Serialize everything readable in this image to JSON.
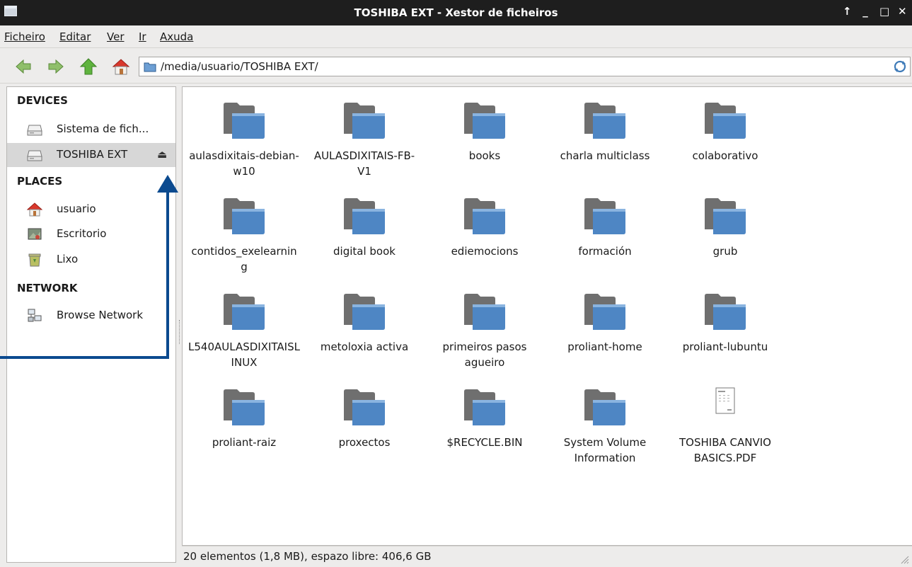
{
  "window": {
    "title": "TOSHIBA EXT - Xestor de ficheiros",
    "controls": [
      "↑",
      "_",
      "□",
      "✕"
    ]
  },
  "menu": [
    {
      "label": "Ficheiro"
    },
    {
      "label": "Editar"
    },
    {
      "label": "Ver"
    },
    {
      "label": "Ir"
    },
    {
      "label": "Axuda"
    }
  ],
  "toolbar": {
    "back_icon": "back-arrow-icon",
    "forward_icon": "forward-arrow-icon",
    "up_icon": "up-arrow-icon",
    "home_icon": "home-icon",
    "path": "/media/usuario/TOSHIBA EXT/",
    "refresh_icon": "refresh-icon"
  },
  "sidebar": {
    "devices_header": "DEVICES",
    "devices": [
      {
        "label": "Sistema de fich...",
        "icon": "drive-icon"
      },
      {
        "label": "TOSHIBA EXT",
        "icon": "drive-icon",
        "selected": true,
        "eject": "⏏"
      }
    ],
    "places_header": "PLACES",
    "places": [
      {
        "label": "usuario",
        "icon": "home-icon"
      },
      {
        "label": "Escritorio",
        "icon": "desktop-icon"
      },
      {
        "label": "Lixo",
        "icon": "trash-icon"
      }
    ],
    "network_header": "NETWORK",
    "network": [
      {
        "label": "Browse Network",
        "icon": "network-icon"
      }
    ]
  },
  "files": [
    {
      "name": "aulasdixitais-debian-w10",
      "type": "folder"
    },
    {
      "name": "AULASDIXITAIS-FB-V1",
      "type": "folder"
    },
    {
      "name": "books",
      "type": "folder"
    },
    {
      "name": "charla multiclass",
      "type": "folder"
    },
    {
      "name": "colaborativo",
      "type": "folder"
    },
    {
      "name": "contidos_exelearning",
      "type": "folder"
    },
    {
      "name": "digital book",
      "type": "folder"
    },
    {
      "name": "ediemocions",
      "type": "folder"
    },
    {
      "name": "formación",
      "type": "folder"
    },
    {
      "name": "grub",
      "type": "folder"
    },
    {
      "name": "L540AULASDIXITAISLINUX",
      "type": "folder"
    },
    {
      "name": "metoloxia activa",
      "type": "folder"
    },
    {
      "name": "primeiros pasos agueiro",
      "type": "folder"
    },
    {
      "name": "proliant-home",
      "type": "folder"
    },
    {
      "name": "proliant-lubuntu",
      "type": "folder"
    },
    {
      "name": "proliant-raiz",
      "type": "folder"
    },
    {
      "name": "proxectos",
      "type": "folder"
    },
    {
      "name": "$RECYCLE.BIN",
      "type": "folder"
    },
    {
      "name": "System Volume Information",
      "type": "folder"
    },
    {
      "name": "TOSHIBA CANVIO BASICS.PDF",
      "type": "pdf"
    }
  ],
  "status": "20 elementos (1,8 MB), espazo libre: 406,6 GB",
  "colors": {
    "titlebar": "#1e1e1e",
    "folder_blue": "#4e86c4",
    "annotation_arrow": "#0b4a8f"
  }
}
